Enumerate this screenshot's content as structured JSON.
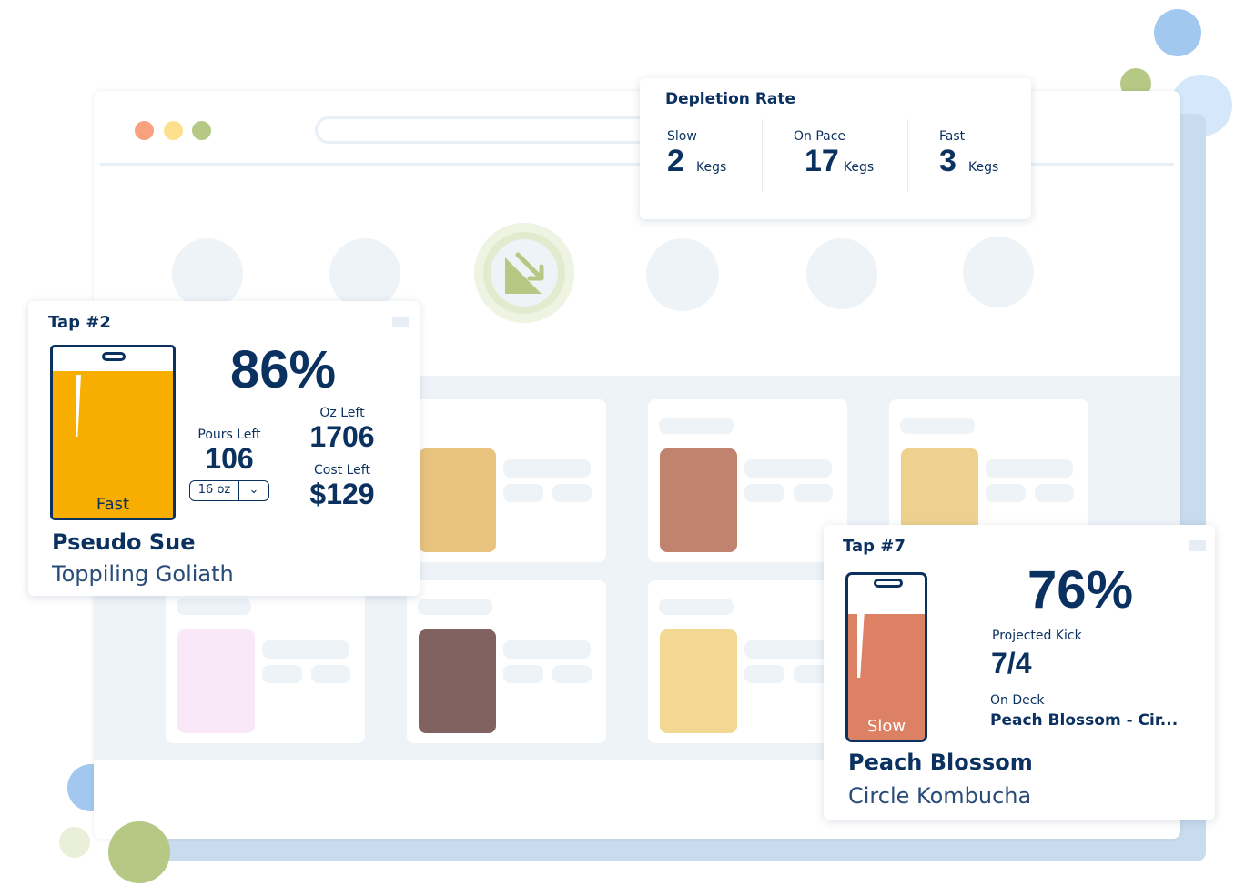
{
  "depletion": {
    "title": "Depletion Rate",
    "items": [
      {
        "label": "Slow",
        "value": "2",
        "unit": "Kegs"
      },
      {
        "label": "On Pace",
        "value": "17",
        "unit": "Kegs"
      },
      {
        "label": "Fast",
        "value": "3",
        "unit": "Kegs"
      }
    ]
  },
  "tap2": {
    "title": "Tap #2",
    "percent": "86%",
    "fill": 0.86,
    "speed": "Fast",
    "fill_color": "#f8ae00",
    "pours_label": "Pours Left",
    "pours": "106",
    "pour_size": "16 oz",
    "oz_label": "Oz Left",
    "oz": "1706",
    "cost_label": "Cost Left",
    "cost": "$129",
    "beer": "Pseudo Sue",
    "brewery": "Toppiling Goliath"
  },
  "tap7": {
    "title": "Tap #7",
    "percent": "76%",
    "fill": 0.76,
    "speed": "Slow",
    "fill_color": "#dc8163",
    "kick_label": "Projected Kick",
    "kick": "7/4",
    "deck_label": "On Deck",
    "deck": "Peach Blossom - Cir...",
    "beer": "Peach Blossom",
    "brewery": "Circle Kombucha"
  },
  "colors": {
    "navy": "#0b3160",
    "accent_green": "#b5c985",
    "panel": "#eef3f8"
  }
}
